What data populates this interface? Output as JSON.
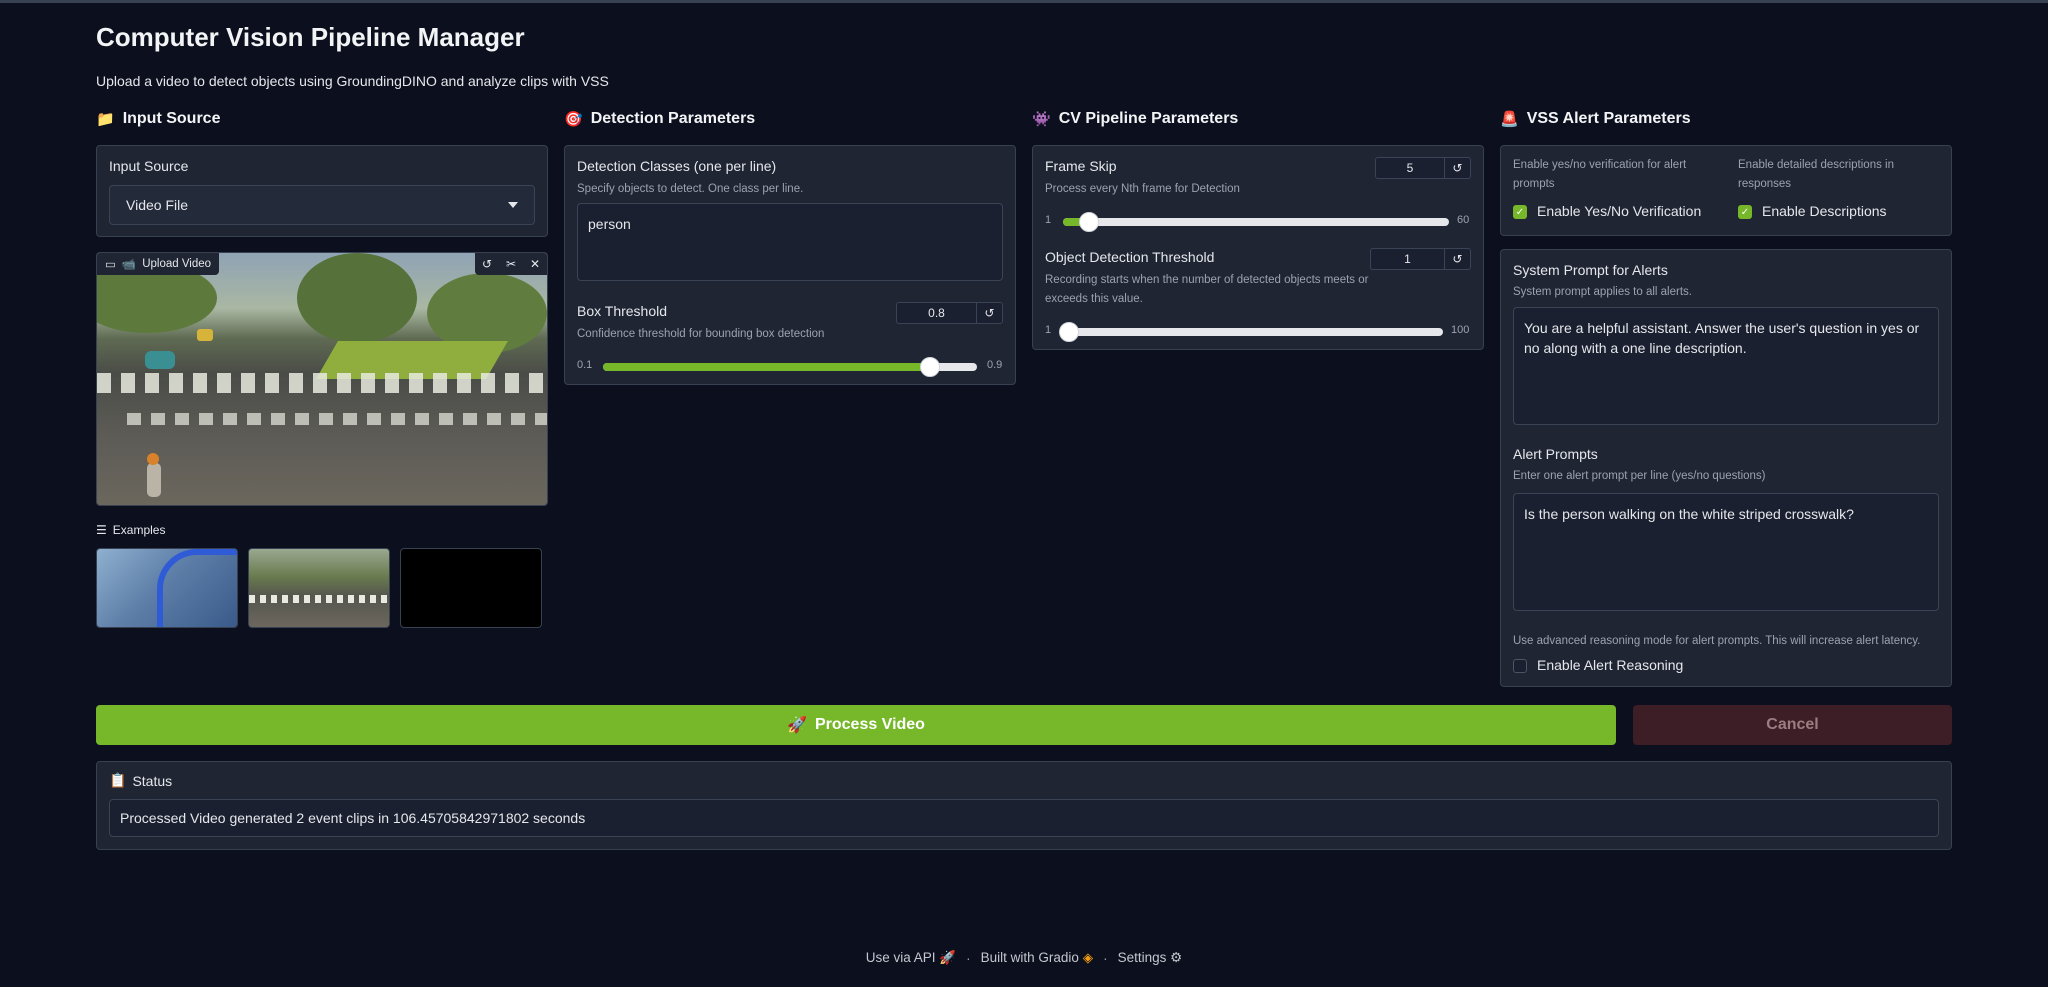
{
  "app": {
    "title": "Computer Vision Pipeline Manager",
    "subtitle": "Upload a video to detect objects using GroundingDINO and analyze clips with VSS"
  },
  "colors": {
    "accent": "#76b82a",
    "background": "#0c0f1e",
    "panel": "#1f2533",
    "cancel": "#3d1d26"
  },
  "input_source": {
    "heading": "Input Source",
    "heading_icon": "📁",
    "dropdown_label": "Input Source",
    "dropdown_value": "Video File",
    "video_tag": "Upload Video",
    "video_tag_icon": "📹",
    "examples_label": "Examples"
  },
  "detection": {
    "heading": "Detection Parameters",
    "heading_icon": "🎯",
    "classes_label": "Detection Classes (one per line)",
    "classes_info": "Specify objects to detect. One class per line.",
    "classes_value": "person",
    "box_threshold_label": "Box Threshold",
    "box_threshold_info": "Confidence threshold for bounding box detection",
    "box_threshold_value": "0.8",
    "box_threshold_min": "0.1",
    "box_threshold_max": "0.9",
    "box_threshold_fraction": 0.875
  },
  "cv_pipeline": {
    "heading": "CV Pipeline Parameters",
    "heading_icon": "👾",
    "frame_skip_label": "Frame Skip",
    "frame_skip_info": "Process every Nth frame for Detection",
    "frame_skip_value": "5",
    "frame_skip_min": "1",
    "frame_skip_max": "60",
    "frame_skip_fraction": 0.068,
    "odt_label": "Object Detection Threshold",
    "odt_info": "Recording starts when the number of detected objects meets or exceeds this value.",
    "odt_value": "1",
    "odt_min": "1",
    "odt_max": "100",
    "odt_fraction": 0.0
  },
  "vss": {
    "heading": "VSS Alert Parameters",
    "heading_icon": "🚨",
    "yesno_info": "Enable yes/no verification for alert prompts",
    "yesno_label": "Enable Yes/No Verification",
    "yesno_checked": true,
    "desc_info": "Enable detailed descriptions in responses",
    "desc_label": "Enable Descriptions",
    "desc_checked": true,
    "system_prompt_label": "System Prompt for Alerts",
    "system_prompt_info": "System prompt applies to all alerts.",
    "system_prompt_value": "You are a helpful assistant. Answer the user's question in yes or no along with a one line description.",
    "alert_prompts_label": "Alert Prompts",
    "alert_prompts_info": "Enter one alert prompt per line (yes/no questions)",
    "alert_prompts_value": "Is the person walking on the white striped crosswalk?",
    "reasoning_info": "Use advanced reasoning mode for alert prompts. This will increase alert latency.",
    "reasoning_label": "Enable Alert Reasoning",
    "reasoning_checked": false
  },
  "actions": {
    "process_label": "Process Video",
    "process_icon": "🚀",
    "cancel_label": "Cancel"
  },
  "status": {
    "label": "Status",
    "icon": "📋",
    "value": "Processed Video generated 2 event clips in 106.45705842971802 seconds"
  },
  "footer": {
    "api": "Use via API",
    "built": "Built with Gradio",
    "settings": "Settings"
  }
}
